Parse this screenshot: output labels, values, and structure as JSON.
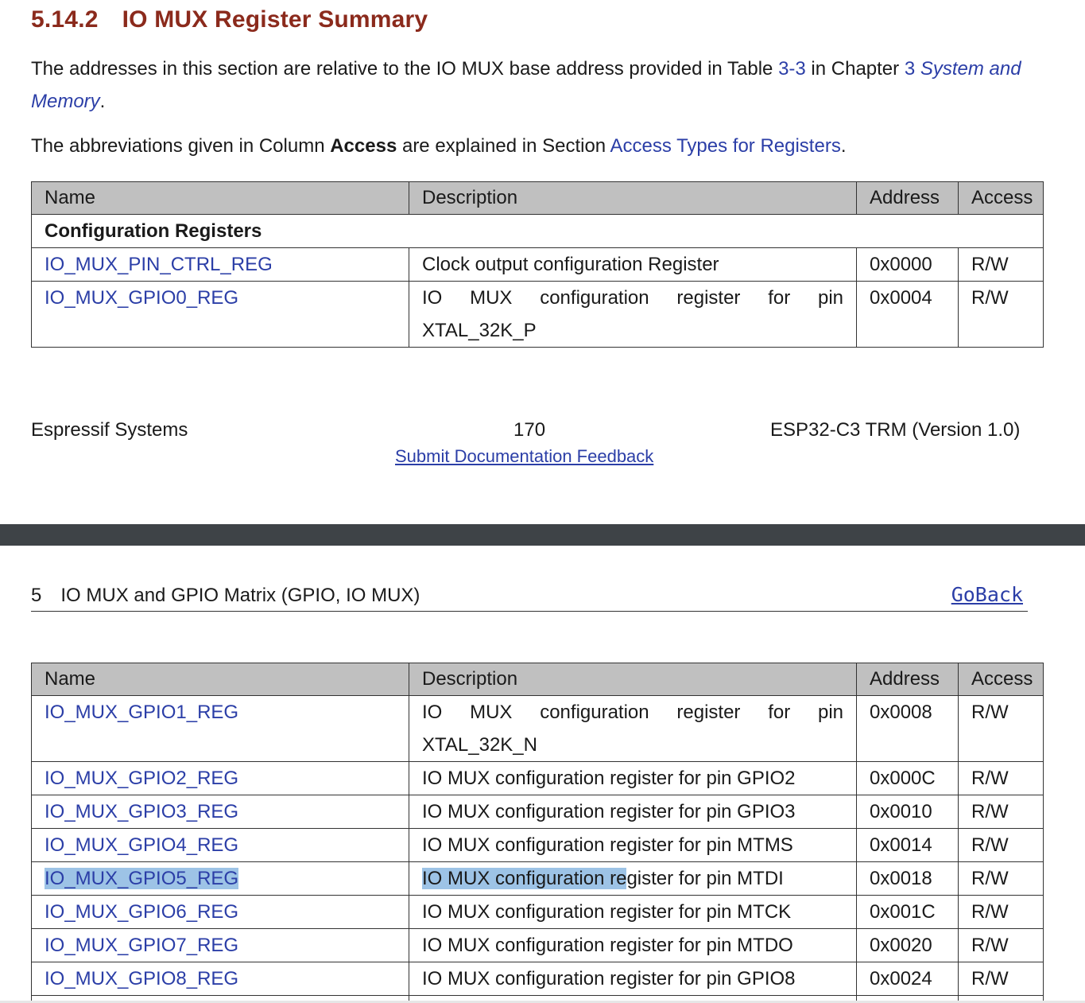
{
  "heading": {
    "number": "5.14.2",
    "title": "IO MUX Register Summary"
  },
  "intro": {
    "p1_part1": "The addresses in this section are relative to the IO MUX base address provided in Table ",
    "p1_link_table": "3-3",
    "p1_part2": " in Chapter ",
    "p1_link_chapter_num": "3",
    "p1_link_chapter_title": "System and Memory",
    "p1_end": ".",
    "p2_part1": "The abbreviations given in Column ",
    "p2_bold": "Access",
    "p2_part2": " are explained in Section ",
    "p2_link": "Access Types for Registers",
    "p2_end": "."
  },
  "table_headers": {
    "name": "Name",
    "description": "Description",
    "address": "Address",
    "access": "Access"
  },
  "table1": {
    "section": "Configuration Registers",
    "rows": [
      {
        "name": "IO_MUX_PIN_CTRL_REG",
        "desc": "Clock output configuration Register",
        "addr": "0x0000",
        "access": "R/W"
      },
      {
        "name": "IO_MUX_GPIO0_REG",
        "desc_line1": "IO MUX configuration register for pin",
        "desc_line2": "XTAL_32K_P",
        "addr": "0x0004",
        "access": "R/W"
      }
    ]
  },
  "footer": {
    "left": "Espressif Systems",
    "page": "170",
    "feedback": "Submit Documentation Feedback",
    "right": "ESP32-C3 TRM (Version 1.0)"
  },
  "chapter_header": {
    "number": "5",
    "title": "IO MUX and GPIO Matrix (GPIO, IO MUX)",
    "goback": "GoBack"
  },
  "table2": {
    "first": {
      "name": "IO_MUX_GPIO1_REG",
      "desc_line1": "IO MUX configuration register for pin",
      "desc_line2": "XTAL_32K_N",
      "addr": "0x0008",
      "access": "R/W"
    },
    "rows": [
      {
        "name": "IO_MUX_GPIO2_REG",
        "desc": "IO MUX configuration register for pin GPIO2",
        "addr": "0x000C",
        "access": "R/W"
      },
      {
        "name": "IO_MUX_GPIO3_REG",
        "desc": "IO MUX configuration register for pin GPIO3",
        "addr": "0x0010",
        "access": "R/W"
      },
      {
        "name": "IO_MUX_GPIO4_REG",
        "desc": "IO MUX configuration register for pin MTMS",
        "addr": "0x0014",
        "access": "R/W"
      },
      {
        "name": "IO_MUX_GPIO5_REG",
        "desc_hl": "IO MUX configuration re",
        "desc_rest": "gister for pin MTDI",
        "addr": "0x0018",
        "access": "R/W"
      },
      {
        "name": "IO_MUX_GPIO6_REG",
        "desc": "IO MUX configuration register for pin MTCK",
        "addr": "0x001C",
        "access": "R/W"
      },
      {
        "name": "IO_MUX_GPIO7_REG",
        "desc": "IO MUX configuration register for pin MTDO",
        "addr": "0x0020",
        "access": "R/W"
      },
      {
        "name": "IO_MUX_GPIO8_REG",
        "desc": "IO MUX configuration register for pin GPIO8",
        "addr": "0x0024",
        "access": "R/W"
      }
    ]
  }
}
